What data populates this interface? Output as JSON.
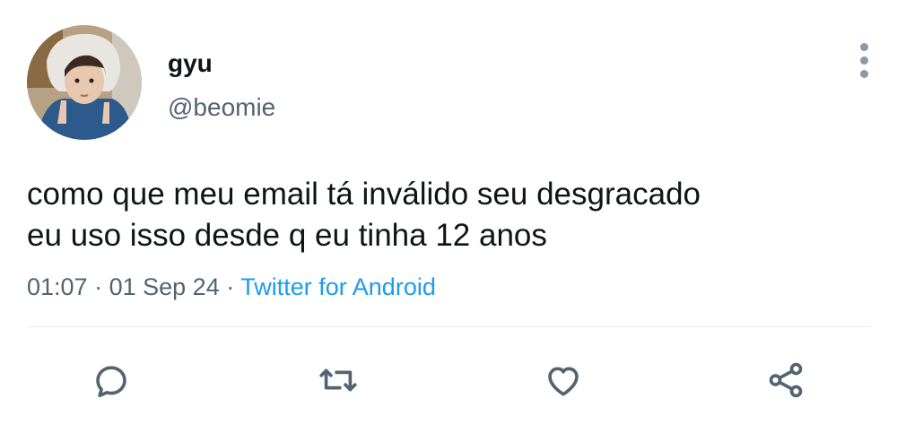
{
  "user": {
    "display_name": "gyu",
    "handle": "@beomie",
    "avatar_icon": "profile-photo"
  },
  "tweet": {
    "text_lines": [
      "como que meu email tá inválido seu desgracado",
      "eu uso isso desde q eu tinha 12 anos"
    ],
    "time": "01:07",
    "date": "01 Sep 24",
    "separator": "·",
    "source": "Twitter for Android"
  },
  "actions": {
    "reply_icon": "reply-icon",
    "retweet_icon": "retweet-icon",
    "like_icon": "heart-icon",
    "share_icon": "share-icon"
  },
  "colors": {
    "text": "#0f1419",
    "secondary": "#536471",
    "link": "#1d9bf0",
    "icon": "#536471"
  }
}
